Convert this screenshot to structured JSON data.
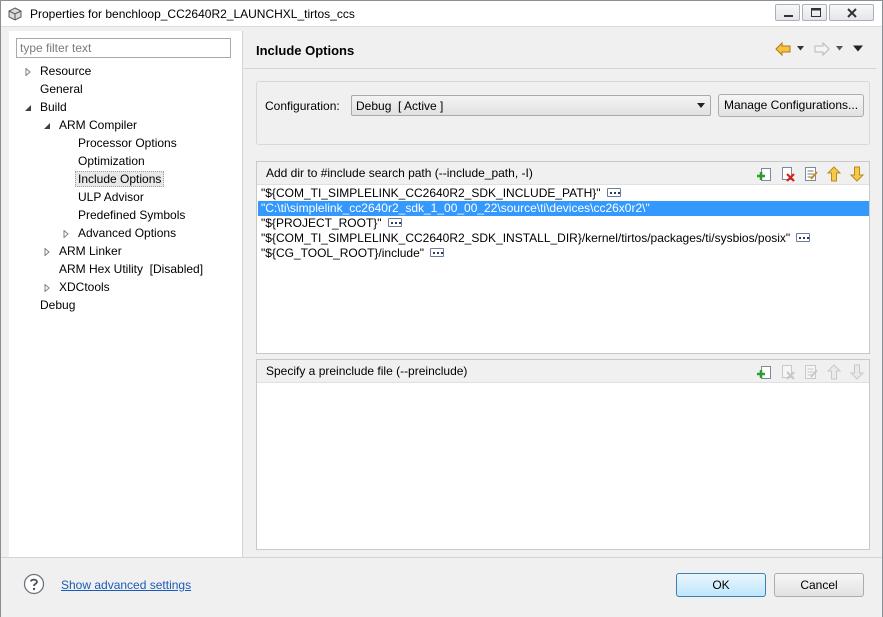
{
  "window": {
    "title": "Properties for benchloop_CC2640R2_LAUNCHXL_tirtos_ccs"
  },
  "sidebar": {
    "filter_placeholder": "type filter text",
    "items": [
      {
        "label": "Resource",
        "expander": "collapsed"
      },
      {
        "label": "General",
        "expander": "none"
      },
      {
        "label": "Build",
        "expander": "expanded"
      },
      {
        "label": "ARM Compiler",
        "expander": "expanded"
      },
      {
        "label": "Processor Options",
        "expander": "none"
      },
      {
        "label": "Optimization",
        "expander": "none"
      },
      {
        "label": "Include Options",
        "expander": "none",
        "selected": true
      },
      {
        "label": "ULP Advisor",
        "expander": "none"
      },
      {
        "label": "Predefined Symbols",
        "expander": "none"
      },
      {
        "label": "Advanced Options",
        "expander": "collapsed"
      },
      {
        "label": "ARM Linker",
        "expander": "collapsed"
      },
      {
        "label": "ARM Hex Utility  [Disabled]",
        "expander": "none"
      },
      {
        "label": "XDCtools",
        "expander": "collapsed"
      },
      {
        "label": "Debug",
        "expander": "none"
      }
    ]
  },
  "main": {
    "page_title": "Include Options",
    "configuration": {
      "label": "Configuration:",
      "selected": "Debug  [ Active ]",
      "manage_button": "Manage Configurations..."
    },
    "include_paths": {
      "title": "Add dir to #include search path (--include_path, -I)",
      "items": [
        {
          "path": "\"${COM_TI_SIMPLELINK_CC2640R2_SDK_INCLUDE_PATH}\"",
          "selected": false
        },
        {
          "path": "\"C:\\ti\\simplelink_cc2640r2_sdk_1_00_00_22\\source\\ti\\devices\\cc26x0r2\\\"",
          "selected": true
        },
        {
          "path": "\"${PROJECT_ROOT}\"",
          "selected": false
        },
        {
          "path": "\"${COM_TI_SIMPLELINK_CC2640R2_SDK_INSTALL_DIR}/kernel/tirtos/packages/ti/sysbios/posix\"",
          "selected": false
        },
        {
          "path": "\"${CG_TOOL_ROOT}/include\"",
          "selected": false
        }
      ]
    },
    "preinclude": {
      "title": "Specify a preinclude file (--preinclude)"
    }
  },
  "footer": {
    "advanced_link": "Show advanced settings",
    "ok": "OK",
    "cancel": "Cancel"
  },
  "colors": {
    "selection": "#3399ff",
    "link": "#1a5bb8",
    "nav_arrow": "#e8a317"
  },
  "icons": [
    "app-icon",
    "minimize-icon",
    "maximize-icon",
    "close-icon",
    "back-arrow-icon",
    "forward-arrow-icon",
    "view-menu-icon",
    "add-icon",
    "delete-icon",
    "edit-icon",
    "move-up-icon",
    "move-down-icon",
    "ellipsis-icon",
    "help-icon"
  ]
}
